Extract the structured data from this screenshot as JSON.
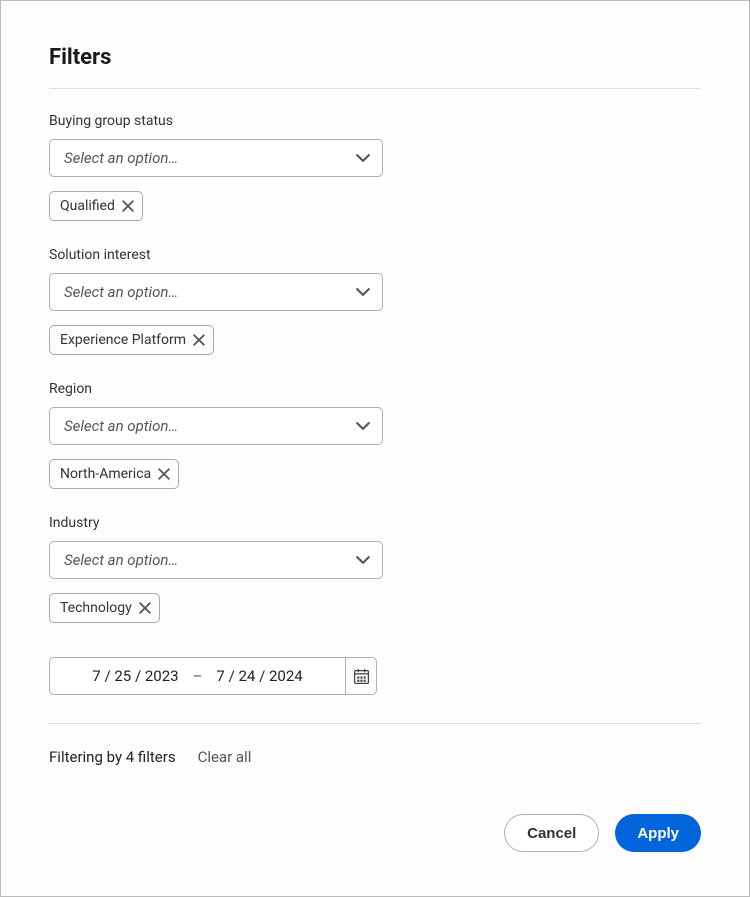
{
  "title": "Filters",
  "filters": {
    "buying_group": {
      "label": "Buying group status",
      "placeholder": "Select an option…",
      "tag": "Qualified"
    },
    "solution_interest": {
      "label": "Solution interest",
      "placeholder": "Select an option…",
      "tag": "Experience Platform"
    },
    "region": {
      "label": "Region",
      "placeholder": "Select an option…",
      "tag": "North-America"
    },
    "industry": {
      "label": "Industry",
      "placeholder": "Select an option…",
      "tag": "Technology"
    }
  },
  "date_range": {
    "start": "7 / 25 / 2023",
    "dash": "–",
    "end": "7 / 24 / 2024"
  },
  "footer": {
    "count_text": "Filtering by 4 filters",
    "clear_label": "Clear all"
  },
  "buttons": {
    "cancel": "Cancel",
    "apply": "Apply"
  }
}
